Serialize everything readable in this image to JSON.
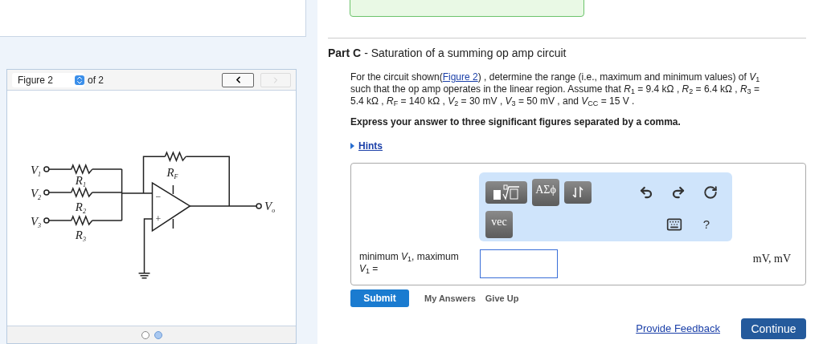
{
  "figure_viewer": {
    "select_value": "Figure 2",
    "count_text": "of 2",
    "prev_disabled": false,
    "next_disabled": true,
    "labels": [
      {
        "symbol": "V",
        "sub": "1",
        "kind": "v1"
      },
      {
        "symbol": "R",
        "sub": "1",
        "kind": "r1"
      },
      {
        "symbol": "V",
        "sub": "2",
        "kind": "v2"
      },
      {
        "symbol": "R",
        "sub": "2",
        "kind": "r2"
      },
      {
        "symbol": "V",
        "sub": "3",
        "kind": "v3"
      },
      {
        "symbol": "R",
        "sub": "3",
        "kind": "r3"
      },
      {
        "symbol": "R",
        "sub": "F",
        "kind": "rf"
      },
      {
        "symbol": "V",
        "sub": "o",
        "kind": "vo"
      },
      {
        "symbol": "−",
        "kind": "minus"
      },
      {
        "symbol": "+",
        "kind": "plus"
      }
    ],
    "pages": [
      {
        "selected": false
      },
      {
        "selected": true
      }
    ]
  },
  "part": {
    "label": "Part C",
    "separator": "-",
    "title": "Saturation of a summing op amp circuit",
    "prompt_before": "For the circuit shown(",
    "figure_link": "Figure 2",
    "prompt_after": ") , determine the range (i.e., maximum and minimum values) of *V*$_{1}$ such that the op amp operates in the linear region. Assume that *R*$_{1}$ = 9.4 kΩ , *R*$_{2}$ = 6.4 kΩ , *R*$_{3}$ = 5.4 kΩ , *R*$_{F}$ = 140 kΩ , *V*$_{2}$ = 30 mV , *V*$_{3}$ = 50 mV , and *V*$_{CC}$ = 15 V .",
    "instruction": "Express your answer to three significant figures separated by a comma.",
    "hints": {
      "label": "Hints",
      "expanded": false
    }
  },
  "answer": {
    "toolbar": [
      {
        "kind": "template"
      },
      {
        "kind": "text",
        "label": "ΑΣϕ"
      },
      {
        "kind": "arrows"
      },
      {
        "kind": "undo"
      },
      {
        "kind": "redo"
      },
      {
        "kind": "reset"
      },
      {
        "kind": "text",
        "label": "vec"
      },
      {
        "kind": "keyboard"
      },
      {
        "kind": "help",
        "label": "?"
      }
    ],
    "field_label": "minimum *V*$_{1}$, maximum *V*$_{1}$ =",
    "units": "mV, mV"
  },
  "actions": {
    "submit": "Submit",
    "my_answers": "My Answers",
    "give_up": "Give Up"
  },
  "footer": {
    "feedback_link": "Provide Feedback",
    "continue": "Continue"
  }
}
